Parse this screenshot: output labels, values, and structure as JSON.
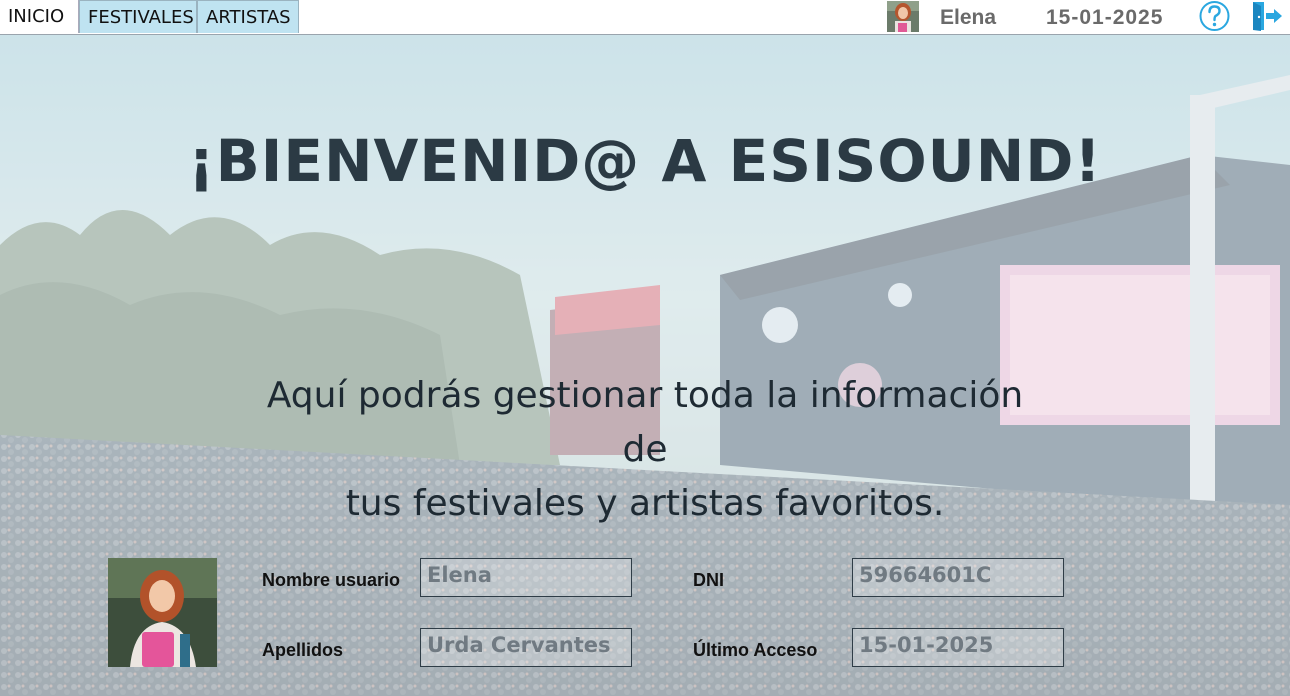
{
  "tabs": [
    {
      "label": "INICIO",
      "active": true
    },
    {
      "label": "FESTIVALES",
      "active": false
    },
    {
      "label": "ARTISTAS",
      "active": false
    }
  ],
  "header": {
    "user_name": "Elena",
    "date": "15-01-2025",
    "icons": [
      "help-icon",
      "logout-icon"
    ]
  },
  "main": {
    "title": "¡BIENVENID@ A ESISOUND!",
    "subtitle_line1": "Aquí podrás gestionar toda la información de",
    "subtitle_line2": "tus festivales y artistas favoritos."
  },
  "profile": {
    "labels": {
      "username": "Nombre usuario",
      "surname": "Apellidos",
      "dni": "DNI",
      "last_access": "Último Acceso"
    },
    "values": {
      "username": "Elena",
      "surname": "Urda Cervantes",
      "dni": "59664601C",
      "last_access": "15-01-2025"
    }
  },
  "colors": {
    "tab_inactive": "#bfe3f1",
    "title": "#2b3a44",
    "help_icon": "#2aa7e0",
    "logout_icon": "#2aa7e0"
  }
}
